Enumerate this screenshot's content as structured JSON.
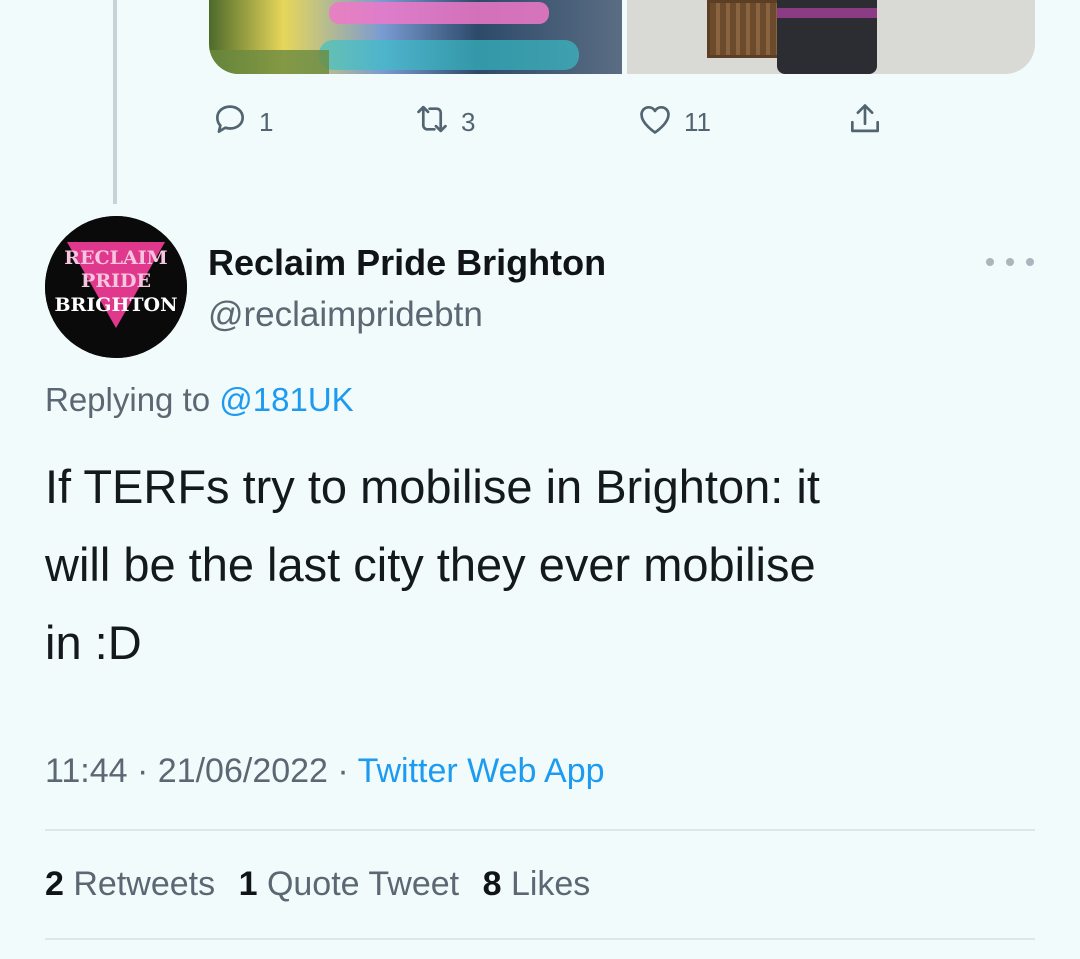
{
  "previous_tweet": {
    "reply_count": "1",
    "retweet_count": "3",
    "like_count": "11"
  },
  "tweet": {
    "display_name": "Reclaim Pride Brighton",
    "handle": "@reclaimpridebtn",
    "avatar_text": [
      "RECLAIM",
      "PRIDE",
      "BRIGHTON"
    ],
    "replying_prefix": "Replying to",
    "replying_to": "@181UK",
    "text": "If TERFs try to mobilise in Brighton: it\nwill be the last city they ever mobilise\nin :D",
    "time": "11:44",
    "date": "21/06/2022",
    "source": "Twitter Web App",
    "stats": {
      "retweets_count": "2",
      "retweets_label": "Retweets",
      "quote_count": "1",
      "quote_label": "Quote Tweet",
      "likes_count": "8",
      "likes_label": "Likes"
    }
  },
  "colors": {
    "background": "#f1fbfb",
    "accent": "#1d9bf0",
    "muted": "#5b6873",
    "avatar_pink": "#e0388c"
  },
  "icons": [
    "reply-icon",
    "retweet-icon",
    "like-icon",
    "share-icon",
    "more-icon"
  ]
}
